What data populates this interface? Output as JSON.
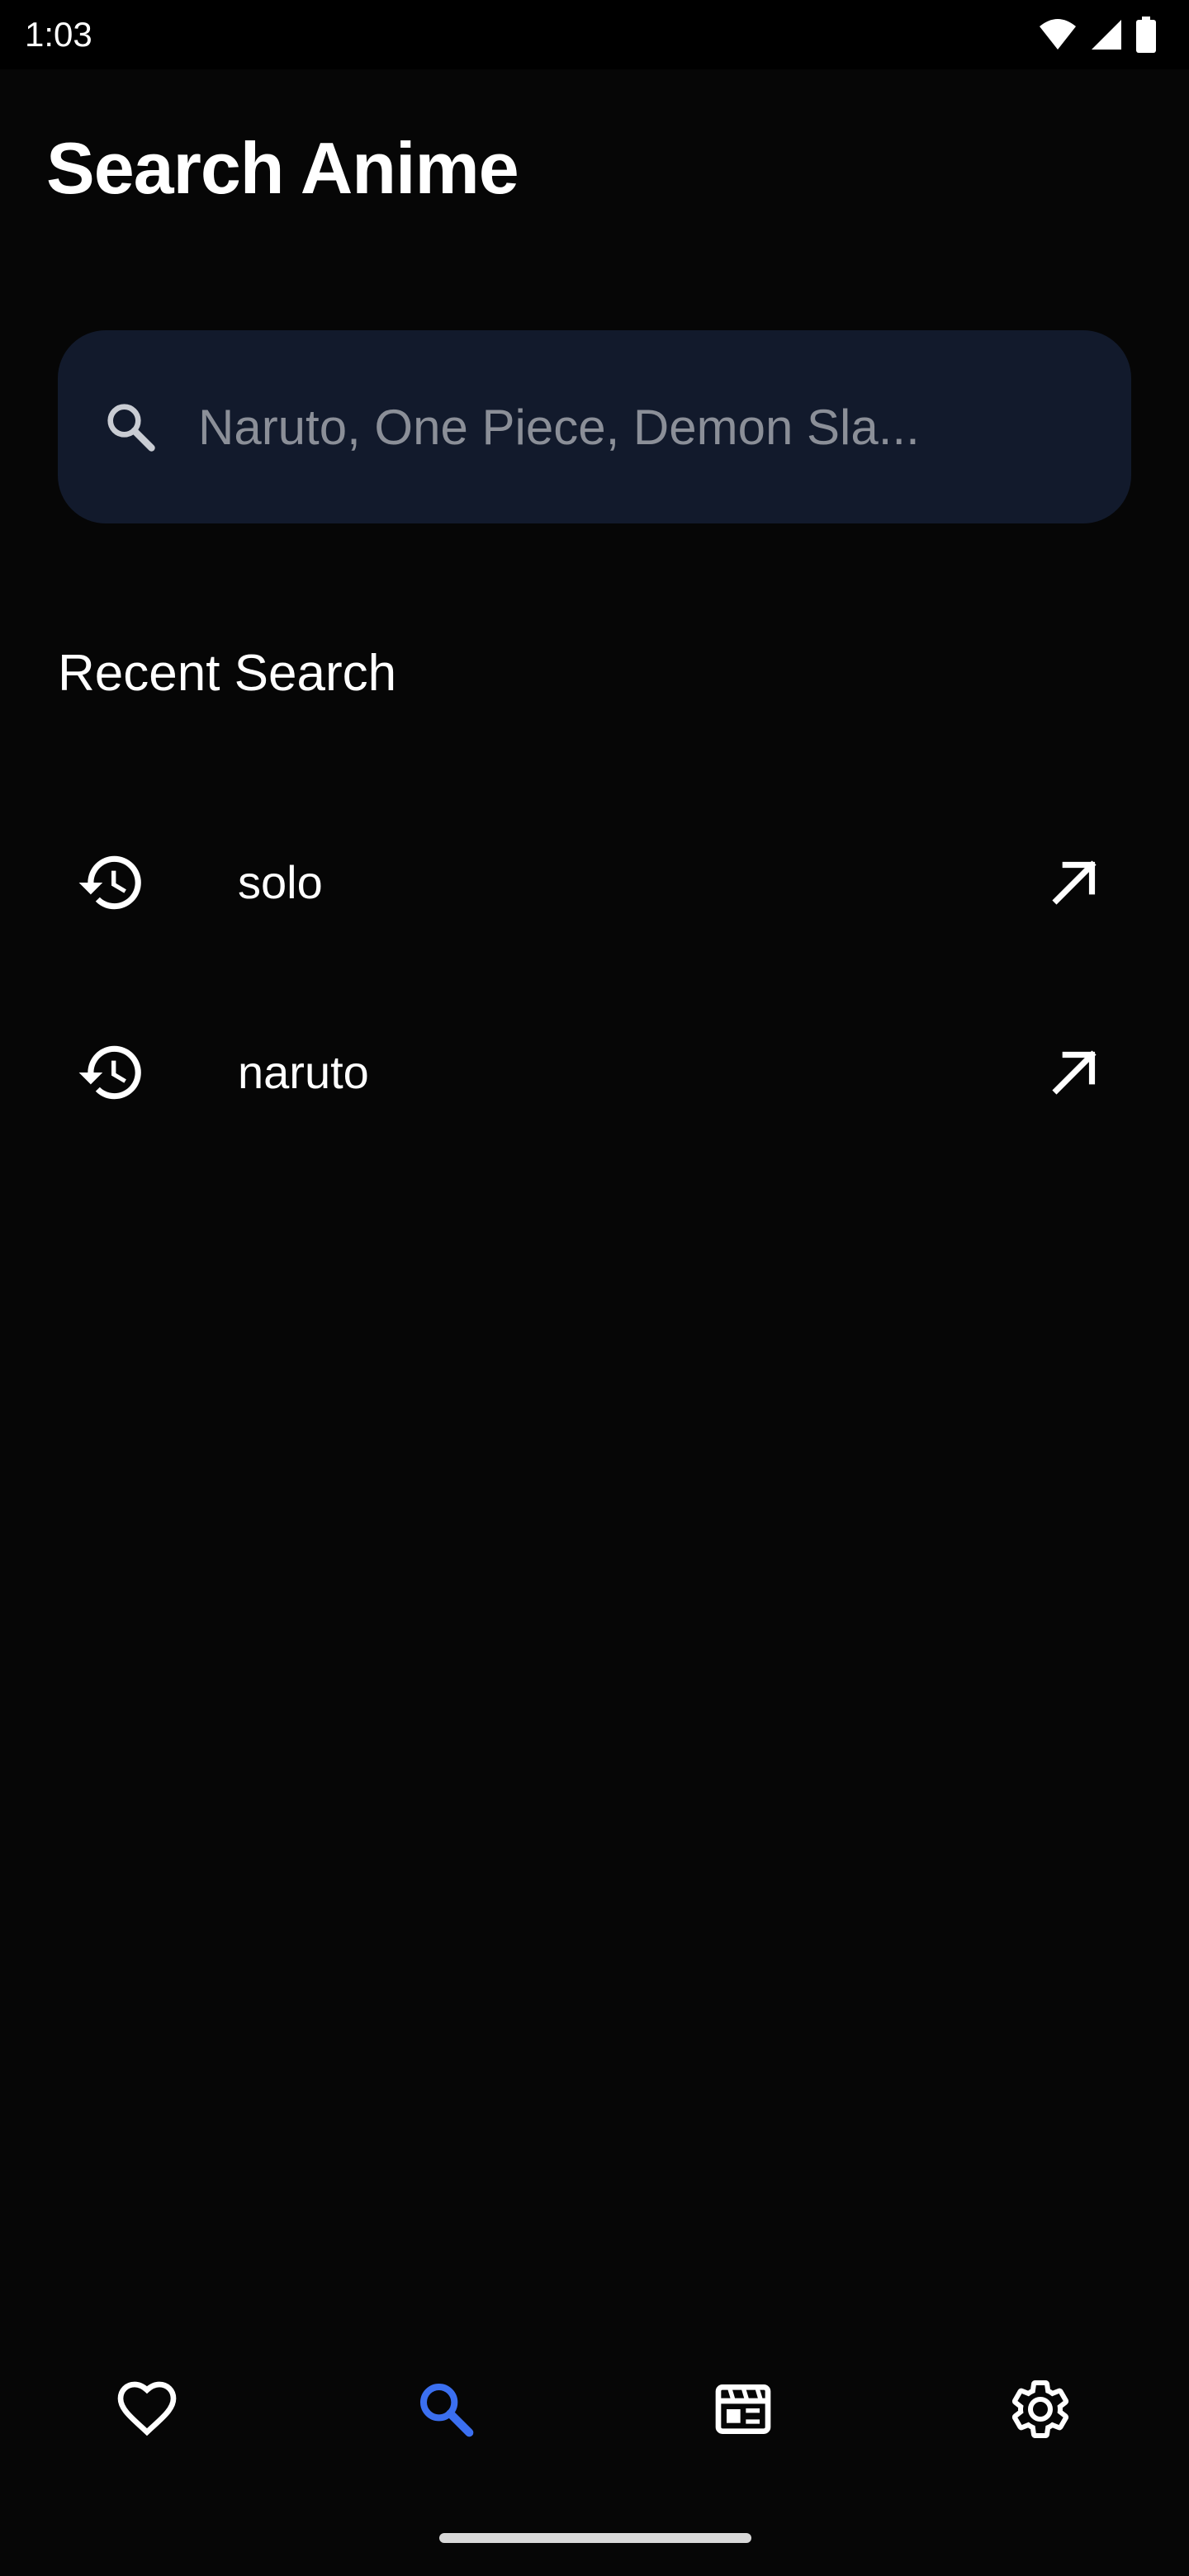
{
  "status_bar": {
    "time": "1:03",
    "icons": [
      "wifi-icon",
      "cellular-signal-icon",
      "battery-icon"
    ]
  },
  "header": {
    "title": "Search Anime"
  },
  "search": {
    "placeholder": "Naruto, One Piece, Demon Sla...",
    "value": "",
    "icon": "search-icon"
  },
  "recent": {
    "title": "Recent Search",
    "items": [
      {
        "label": "solo",
        "leading_icon": "history-icon",
        "trailing_icon": "arrow-up-right-icon"
      },
      {
        "label": "naruto",
        "leading_icon": "history-icon",
        "trailing_icon": "arrow-up-right-icon"
      }
    ]
  },
  "bottom_nav": {
    "items": [
      {
        "name": "favorites",
        "icon": "heart-icon",
        "active": false
      },
      {
        "name": "search",
        "icon": "search-icon",
        "active": true
      },
      {
        "name": "schedule",
        "icon": "calendar-icon",
        "active": false
      },
      {
        "name": "settings",
        "icon": "gear-icon",
        "active": false
      }
    ]
  },
  "colors": {
    "background": "#060606",
    "search_field": "#121a2c",
    "placeholder": "#8b8f98",
    "accent": "#3b6ff0",
    "text": "#ffffff"
  }
}
